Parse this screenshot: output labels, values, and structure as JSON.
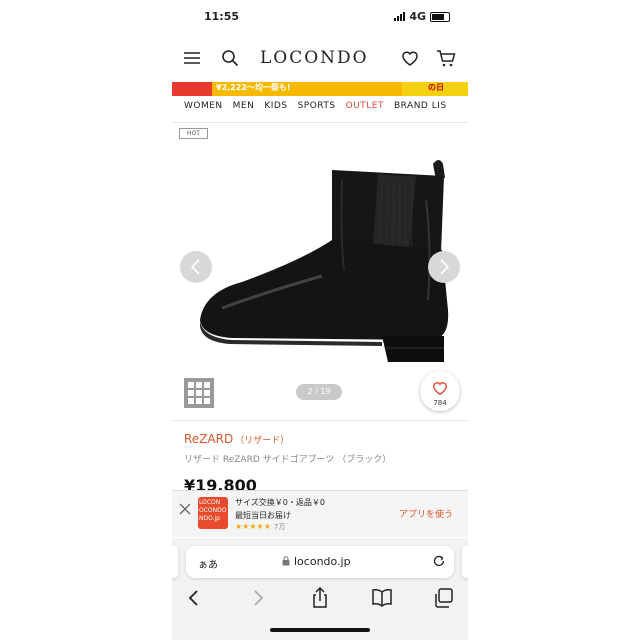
{
  "status": {
    "time": "11:55",
    "network": "4G"
  },
  "header": {
    "logo": "LOCONDO"
  },
  "banner": {
    "text": "¥2,222〜均一祭も!",
    "right_text": "の日"
  },
  "nav": {
    "items": [
      "WOMEN",
      "MEN",
      "KIDS",
      "SPORTS",
      "OUTLET",
      "BRAND LIS"
    ]
  },
  "product": {
    "badge": "HOT",
    "image_counter": "2 / 19",
    "favorite_count": "784",
    "brand": "ReZARD",
    "brand_jp": "（リザード）",
    "name": "リザード ReZARD サイドゴアブーツ （ブラック）",
    "price": "¥19,800"
  },
  "app_banner": {
    "icon_text": [
      "LOCON",
      "OCONDO",
      "NDO.jp"
    ],
    "line1": "サイズ交換￥0・返品￥0",
    "line2": "最短当日お届け",
    "stars": "★★★★★",
    "rating_count": "7万",
    "cta": "アプリを使う"
  },
  "browser": {
    "aa": "ぁあ",
    "url": "locondo.jp"
  },
  "colors": {
    "accent": "#d9582d",
    "banner_yellow": "#f7b800",
    "banner_red": "#e53a2d"
  },
  "icons": [
    "menu-icon",
    "search-icon",
    "heart-icon",
    "cart-icon",
    "chevron-left-icon",
    "chevron-right-icon",
    "grid-icon",
    "close-icon",
    "lock-icon",
    "reload-icon",
    "back-icon",
    "forward-icon",
    "share-icon",
    "bookmarks-icon",
    "tabs-icon"
  ]
}
